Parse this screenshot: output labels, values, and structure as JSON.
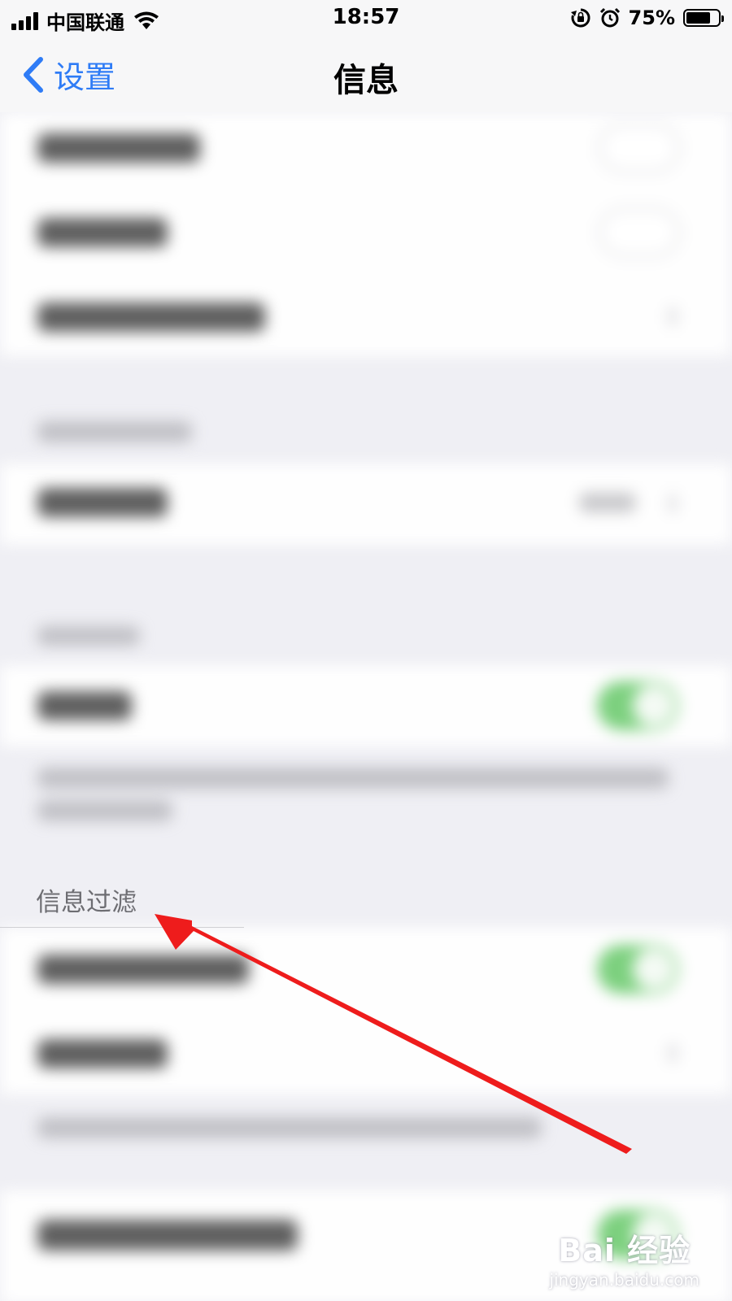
{
  "status_bar": {
    "carrier": "中国联通",
    "time": "18:57",
    "battery_percent": "75%",
    "battery_level": 0.75,
    "icons": [
      "signal-icon",
      "wifi-icon",
      "orientation-lock-icon",
      "alarm-icon",
      "battery-icon"
    ]
  },
  "nav": {
    "back_label": "设置",
    "title": "信息"
  },
  "sections": {
    "filter_header": "信息过滤"
  },
  "toggles": {
    "row2_on": true,
    "row6_on": true,
    "row7_on": true
  },
  "colors": {
    "accent": "#2f7cf6",
    "toggle_on": "#7cd07e",
    "annotation_arrow": "#ee1c1c"
  },
  "watermark": {
    "logo": "Bai 经验",
    "url": "jingyan.baidu.com"
  }
}
